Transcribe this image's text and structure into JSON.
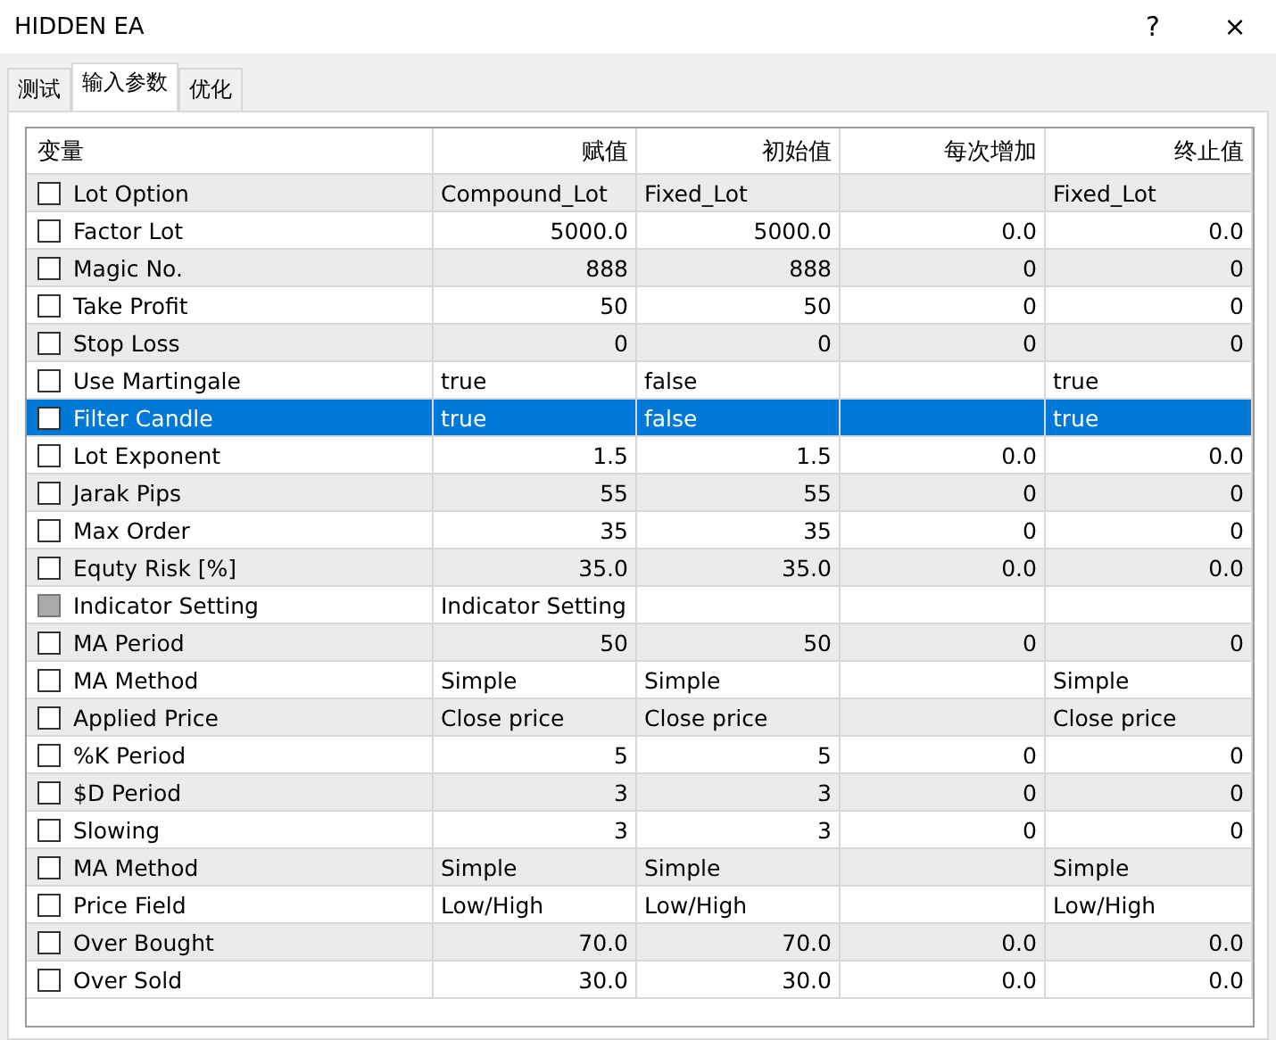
{
  "window": {
    "title": "HIDDEN EA",
    "help": "?",
    "close": "×"
  },
  "tabs": [
    {
      "label": "测试",
      "selected": false
    },
    {
      "label": "输入参数",
      "selected": true
    },
    {
      "label": "优化",
      "selected": false
    }
  ],
  "table": {
    "columns": [
      "变量",
      "赋值",
      "初始值",
      "每次增加",
      "终止值"
    ],
    "rows": [
      {
        "name": "Lot Option",
        "kind": "text",
        "checked": false,
        "disabled": false,
        "selected": false,
        "value": "Compound_Lot",
        "start": "Fixed_Lot",
        "stop": "Fixed_Lot"
      },
      {
        "name": "Factor Lot",
        "kind": "number",
        "checked": false,
        "disabled": false,
        "selected": false,
        "value": "5000.0",
        "start": "5000.0",
        "step": "0.0",
        "stop": "0.0"
      },
      {
        "name": "Magic No.",
        "kind": "number",
        "checked": false,
        "disabled": false,
        "selected": false,
        "value": "888",
        "start": "888",
        "step": "0",
        "stop": "0"
      },
      {
        "name": "Take Profit",
        "kind": "number",
        "checked": false,
        "disabled": false,
        "selected": false,
        "value": "50",
        "start": "50",
        "step": "0",
        "stop": "0"
      },
      {
        "name": "Stop Loss",
        "kind": "number",
        "checked": false,
        "disabled": false,
        "selected": false,
        "value": "0",
        "start": "0",
        "step": "0",
        "stop": "0"
      },
      {
        "name": "Use Martingale",
        "kind": "text",
        "checked": false,
        "disabled": false,
        "selected": false,
        "value": "true",
        "start": "false",
        "stop": "true"
      },
      {
        "name": "Filter Candle",
        "kind": "text",
        "checked": false,
        "disabled": false,
        "selected": true,
        "value": "true",
        "start": "false",
        "stop": "true"
      },
      {
        "name": "Lot Exponent",
        "kind": "number",
        "checked": false,
        "disabled": false,
        "selected": false,
        "value": "1.5",
        "start": "1.5",
        "step": "0.0",
        "stop": "0.0"
      },
      {
        "name": "Jarak Pips",
        "kind": "number",
        "checked": false,
        "disabled": false,
        "selected": false,
        "value": "55",
        "start": "55",
        "step": "0",
        "stop": "0"
      },
      {
        "name": "Max Order",
        "kind": "number",
        "checked": false,
        "disabled": false,
        "selected": false,
        "value": "35",
        "start": "35",
        "step": "0",
        "stop": "0"
      },
      {
        "name": "Equty Risk [%]",
        "kind": "number",
        "checked": false,
        "disabled": false,
        "selected": false,
        "value": "35.0",
        "start": "35.0",
        "step": "0.0",
        "stop": "0.0"
      },
      {
        "name": "Indicator Setting",
        "kind": "text",
        "checked": false,
        "disabled": true,
        "selected": false,
        "value": "Indicator Setting"
      },
      {
        "name": "MA Period",
        "kind": "number",
        "checked": false,
        "disabled": false,
        "selected": false,
        "value": "50",
        "start": "50",
        "step": "0",
        "stop": "0"
      },
      {
        "name": "MA Method",
        "kind": "text",
        "checked": false,
        "disabled": false,
        "selected": false,
        "value": "Simple",
        "start": "Simple",
        "stop": "Simple"
      },
      {
        "name": "Applied Price",
        "kind": "text",
        "checked": false,
        "disabled": false,
        "selected": false,
        "value": "Close price",
        "start": "Close price",
        "stop": "Close price"
      },
      {
        "name": "%K Period",
        "kind": "number",
        "checked": false,
        "disabled": false,
        "selected": false,
        "value": "5",
        "start": "5",
        "step": "0",
        "stop": "0"
      },
      {
        "name": "$D Period",
        "kind": "number",
        "checked": false,
        "disabled": false,
        "selected": false,
        "value": "3",
        "start": "3",
        "step": "0",
        "stop": "0"
      },
      {
        "name": "Slowing",
        "kind": "number",
        "checked": false,
        "disabled": false,
        "selected": false,
        "value": "3",
        "start": "3",
        "step": "0",
        "stop": "0"
      },
      {
        "name": "MA Method",
        "kind": "text",
        "checked": false,
        "disabled": false,
        "selected": false,
        "value": "Simple",
        "start": "Simple",
        "stop": "Simple"
      },
      {
        "name": "Price Field",
        "kind": "text",
        "checked": false,
        "disabled": false,
        "selected": false,
        "value": "Low/High",
        "start": "Low/High",
        "stop": "Low/High"
      },
      {
        "name": "Over Bought",
        "kind": "number",
        "checked": false,
        "disabled": false,
        "selected": false,
        "value": "70.0",
        "start": "70.0",
        "step": "0.0",
        "stop": "0.0"
      },
      {
        "name": "Over Sold",
        "kind": "number",
        "checked": false,
        "disabled": false,
        "selected": false,
        "value": "30.0",
        "start": "30.0",
        "step": "0.0",
        "stop": "0.0"
      }
    ]
  }
}
